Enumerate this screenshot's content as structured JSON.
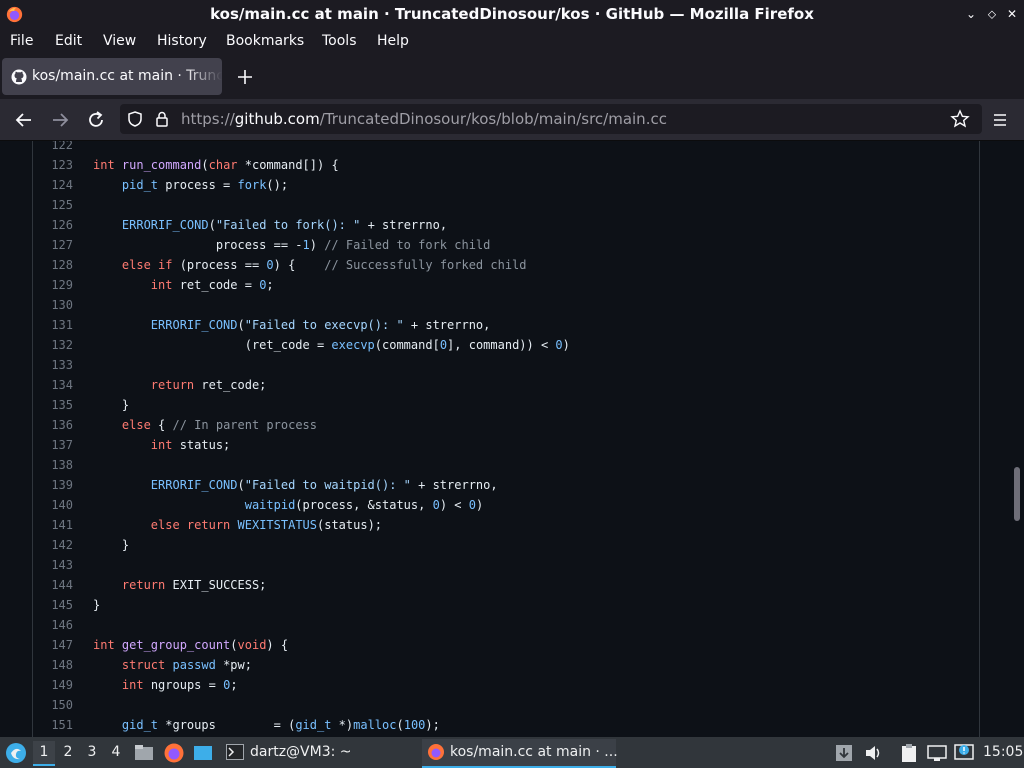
{
  "window": {
    "title": "kos/main.cc at main · TruncatedDinosour/kos · GitHub — Mozilla Firefox",
    "buttons": {
      "minimize": "⌄",
      "maximize": "⬦",
      "close": "✕"
    }
  },
  "menu": [
    "File",
    "Edit",
    "View",
    "History",
    "Bookmarks",
    "Tools",
    "Help"
  ],
  "tab": {
    "title": "kos/main.cc at main · TruncatedDinosour/kos · GitHub",
    "icon": "github-icon"
  },
  "url": {
    "prefix": "https://",
    "domain": "github.com",
    "path": "/TruncatedDinosour/kos/blob/main/src/main.cc"
  },
  "code": [
    {
      "n": "122",
      "t": []
    },
    {
      "n": "123",
      "t": [
        [
          "kw",
          "int "
        ],
        [
          "fn",
          "run_command"
        ],
        [
          "",
          "("
        ],
        [
          "kw",
          "char"
        ],
        [
          "",
          ""
        ],
        [
          "",
          " *command[]) {"
        ]
      ]
    },
    {
      "n": "124",
      "t": [
        [
          "",
          "    "
        ],
        [
          "en",
          "pid_t"
        ],
        [
          "",
          " process = "
        ],
        [
          "en",
          "fork"
        ],
        [
          "",
          "();"
        ]
      ]
    },
    {
      "n": "125",
      "t": []
    },
    {
      "n": "126",
      "t": [
        [
          "",
          "    "
        ],
        [
          "en",
          "ERRORIF_COND"
        ],
        [
          "",
          "("
        ],
        [
          "st",
          "\"Failed to fork(): \""
        ],
        [
          "",
          " + strerrno,"
        ]
      ]
    },
    {
      "n": "127",
      "t": [
        [
          "",
          "                 process == -"
        ],
        [
          "en",
          "1"
        ],
        [
          "",
          ") "
        ],
        [
          "cm",
          "// Failed to fork child"
        ]
      ]
    },
    {
      "n": "128",
      "t": [
        [
          "",
          "    "
        ],
        [
          "kw",
          "else if"
        ],
        [
          "",
          " (process == "
        ],
        [
          "en",
          "0"
        ],
        [
          "",
          ") {    "
        ],
        [
          "cm",
          "// Successfully forked child"
        ]
      ]
    },
    {
      "n": "129",
      "t": [
        [
          "",
          "        "
        ],
        [
          "kw",
          "int"
        ],
        [
          "",
          " ret_code = "
        ],
        [
          "en",
          "0"
        ],
        [
          "",
          ";"
        ]
      ]
    },
    {
      "n": "130",
      "t": []
    },
    {
      "n": "131",
      "t": [
        [
          "",
          "        "
        ],
        [
          "en",
          "ERRORIF_COND"
        ],
        [
          "",
          "("
        ],
        [
          "st",
          "\"Failed to execvp(): \""
        ],
        [
          "",
          " + strerrno,"
        ]
      ]
    },
    {
      "n": "132",
      "t": [
        [
          "",
          "                     (ret_code = "
        ],
        [
          "en",
          "execvp"
        ],
        [
          "",
          "(command["
        ],
        [
          "en",
          "0"
        ],
        [
          "",
          "], command)) < "
        ],
        [
          "en",
          "0"
        ],
        [
          "",
          ")"
        ]
      ]
    },
    {
      "n": "133",
      "t": []
    },
    {
      "n": "134",
      "t": [
        [
          "",
          "        "
        ],
        [
          "kw",
          "return"
        ],
        [
          "",
          " ret_code;"
        ]
      ]
    },
    {
      "n": "135",
      "t": [
        [
          "",
          "    }"
        ]
      ]
    },
    {
      "n": "136",
      "t": [
        [
          "",
          "    "
        ],
        [
          "kw",
          "else"
        ],
        [
          "",
          " { "
        ],
        [
          "cm",
          "// In parent process"
        ]
      ]
    },
    {
      "n": "137",
      "t": [
        [
          "",
          "        "
        ],
        [
          "kw",
          "int"
        ],
        [
          "",
          " status;"
        ]
      ]
    },
    {
      "n": "138",
      "t": []
    },
    {
      "n": "139",
      "t": [
        [
          "",
          "        "
        ],
        [
          "en",
          "ERRORIF_COND"
        ],
        [
          "",
          "("
        ],
        [
          "st",
          "\"Failed to waitpid(): \""
        ],
        [
          "",
          " + strerrno,"
        ]
      ]
    },
    {
      "n": "140",
      "t": [
        [
          "",
          "                     "
        ],
        [
          "en",
          "waitpid"
        ],
        [
          "",
          "(process, &status, "
        ],
        [
          "en",
          "0"
        ],
        [
          "",
          ") < "
        ],
        [
          "en",
          "0"
        ],
        [
          "",
          ")"
        ]
      ]
    },
    {
      "n": "141",
      "t": [
        [
          "",
          "        "
        ],
        [
          "kw",
          "else return"
        ],
        [
          "",
          " "
        ],
        [
          "en",
          "WEXITSTATUS"
        ],
        [
          "",
          "(status);"
        ]
      ]
    },
    {
      "n": "142",
      "t": [
        [
          "",
          "    }"
        ]
      ]
    },
    {
      "n": "143",
      "t": []
    },
    {
      "n": "144",
      "t": [
        [
          "",
          "    "
        ],
        [
          "kw",
          "return"
        ],
        [
          "",
          " EXIT_SUCCESS;"
        ]
      ]
    },
    {
      "n": "145",
      "t": [
        [
          "",
          "}"
        ]
      ]
    },
    {
      "n": "146",
      "t": []
    },
    {
      "n": "147",
      "t": [
        [
          "kw",
          "int "
        ],
        [
          "fn",
          "get_group_count"
        ],
        [
          "",
          "("
        ],
        [
          "kw",
          "void"
        ],
        [
          "",
          ") {"
        ]
      ]
    },
    {
      "n": "148",
      "t": [
        [
          "",
          "    "
        ],
        [
          "kw",
          "struct"
        ],
        [
          "",
          " "
        ],
        [
          "en",
          "passwd"
        ],
        [
          "",
          " *pw;"
        ]
      ]
    },
    {
      "n": "149",
      "t": [
        [
          "",
          "    "
        ],
        [
          "kw",
          "int"
        ],
        [
          "",
          " ngroups = "
        ],
        [
          "en",
          "0"
        ],
        [
          "",
          ";"
        ]
      ]
    },
    {
      "n": "150",
      "t": []
    },
    {
      "n": "151",
      "t": [
        [
          "",
          "    "
        ],
        [
          "en",
          "gid_t"
        ],
        [
          "",
          " *groups        = ("
        ],
        [
          "en",
          "gid_t"
        ],
        [
          "",
          " *)"
        ],
        [
          "en",
          "malloc"
        ],
        [
          "",
          "("
        ],
        [
          "en",
          "100"
        ],
        [
          "",
          ");"
        ]
      ]
    }
  ],
  "taskbar": {
    "workspaces": [
      "1",
      "2",
      "3",
      "4"
    ],
    "terminal_task": "dartz@VM3: ~",
    "browser_task": "kos/main.cc at main · ...",
    "clock": "15:05"
  }
}
